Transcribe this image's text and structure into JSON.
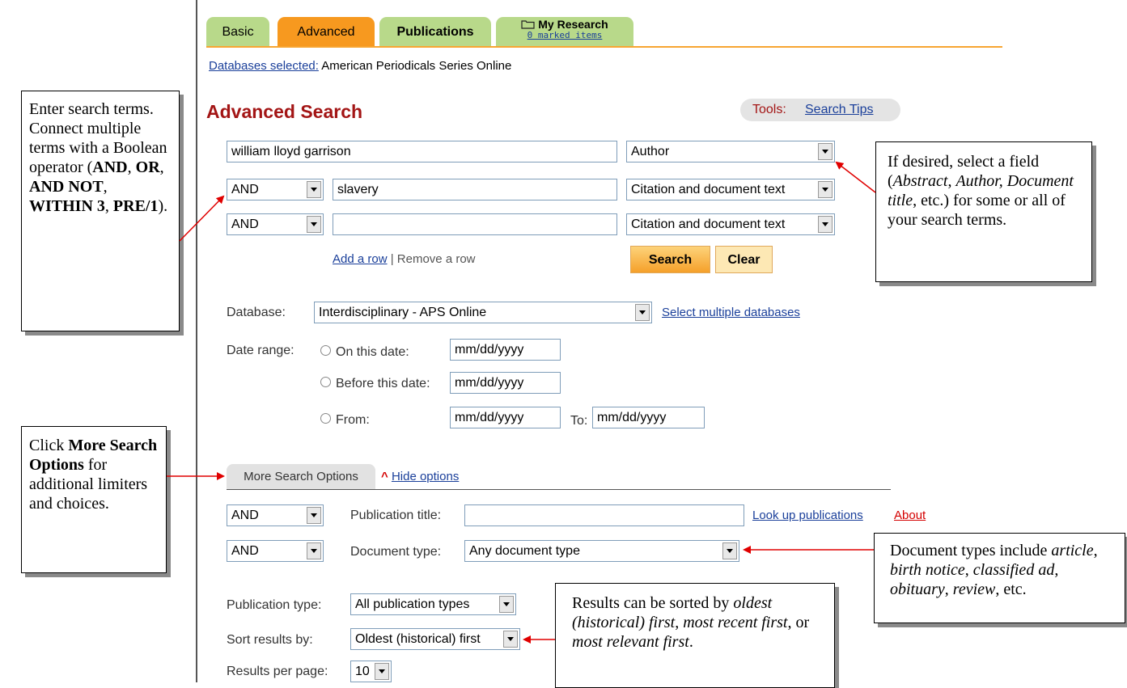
{
  "tabs": {
    "basic": "Basic",
    "advanced": "Advanced",
    "publications": "Publications",
    "my_research": "My Research",
    "marked_items": "0 marked items"
  },
  "databases_selected": {
    "label": "Databases selected:",
    "value": "American Periodicals Series Online"
  },
  "page_title": "Advanced Search",
  "tools": {
    "label": "Tools:",
    "search_tips": "Search Tips"
  },
  "search_rows": [
    {
      "term": "william lloyd garrison",
      "field": "Author"
    },
    {
      "operator": "AND",
      "term": "slavery",
      "field": "Citation and document text"
    },
    {
      "operator": "AND",
      "term": "",
      "field": "Citation and document text"
    }
  ],
  "row_actions": {
    "add": "Add a row",
    "separator": "|",
    "remove": "Remove a row"
  },
  "buttons": {
    "search": "Search",
    "clear": "Clear"
  },
  "database": {
    "label": "Database:",
    "value": "Interdisciplinary - APS Online",
    "select_multiple": "Select multiple databases"
  },
  "date_range": {
    "label": "Date range:",
    "on_this_date": "On this date:",
    "before_this_date": "Before this date:",
    "from": "From:",
    "to": "To:",
    "placeholder": "mm/dd/yyyy"
  },
  "more_options": {
    "tab": "More Search Options",
    "caret": "^",
    "hide": "Hide options"
  },
  "publication_title": {
    "operator": "AND",
    "label": "Publication title:",
    "value": "",
    "lookup": "Look up publications",
    "about": "About"
  },
  "document_type": {
    "operator": "AND",
    "label": "Document type:",
    "value": "Any document type"
  },
  "publication_type": {
    "label": "Publication type:",
    "value": "All publication types"
  },
  "sort_results": {
    "label": "Sort results by:",
    "value": "Oldest (historical) first"
  },
  "results_per_page": {
    "label": "Results per page:",
    "value": "10"
  },
  "callouts": {
    "enter_terms": {
      "t1": "Enter search terms. Connect multiple terms with a Boolean operator (",
      "and": "AND",
      "c1": ", ",
      "or": "OR",
      "c2": ", ",
      "and_not": "AND NOT",
      "c3": ", ",
      "within": "WITHIN 3",
      "c4": ", ",
      "pre": "PRE/1",
      "t2": ")."
    },
    "more_options": {
      "t1": "Click ",
      "bold": "More Search Options",
      "t2": " for additional limiters and choices."
    },
    "select_field": {
      "t1": "If desired, select a field (",
      "abstract": "Abstract",
      "c1": ", ",
      "author": "Author, Document title",
      "t2": ", etc.) for some or all of your search terms."
    },
    "document_types": {
      "t1": "Document types include ",
      "article": "article",
      "c1": ", ",
      "birth": "birth notice",
      "c2": ", ",
      "classified": "classified ad",
      "c3": ", ",
      "obituary": "obituary",
      "c4": ", ",
      "review": "review",
      "t2": ", etc."
    },
    "sorting": {
      "t1": "Results can be sorted by ",
      "oldest": "oldest (historical) first",
      "c1": ", ",
      "recent": "most recent first",
      "c2": ", or ",
      "relevant": "most relevant first",
      "t2": "."
    }
  },
  "colors": {
    "arrow": "#e00000",
    "tab_green": "#b8d98a",
    "tab_orange": "#f7991f",
    "title": "#a31515"
  }
}
